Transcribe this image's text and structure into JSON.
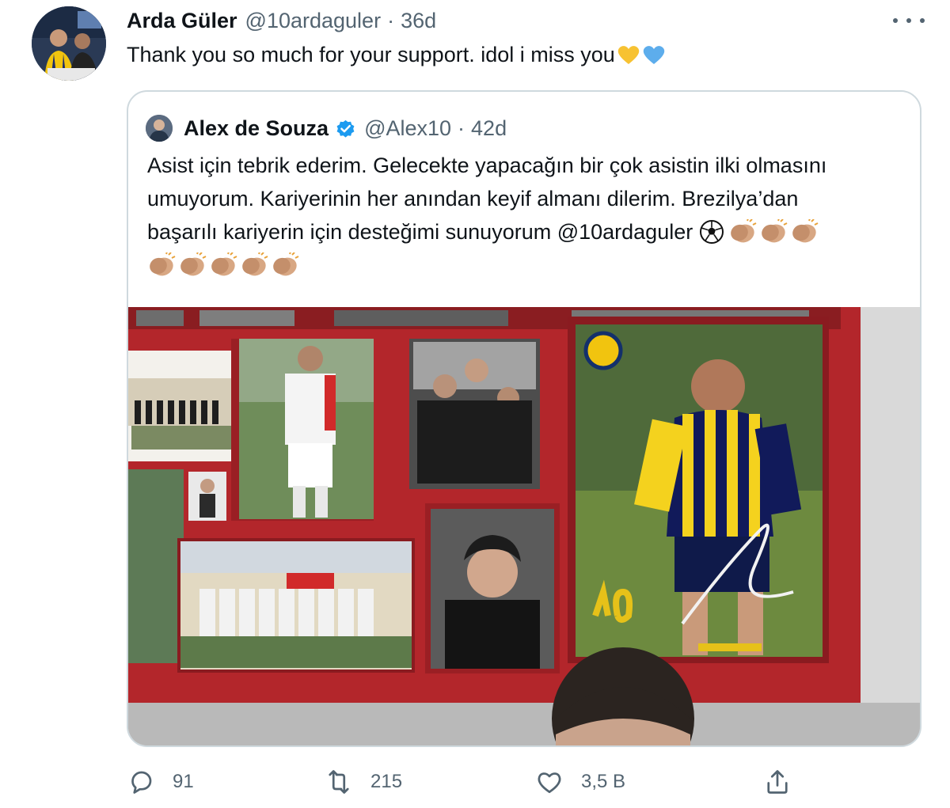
{
  "tweet": {
    "author_name": "Arda Güler",
    "author_handle": "@10ardaguler",
    "separator": "·",
    "time": "36d",
    "text": "Thank you so much for your support. idol i miss you",
    "emojis": [
      "yellow-heart",
      "blue-heart"
    ]
  },
  "quote": {
    "author_name": "Alex de Souza",
    "verified": true,
    "author_handle": "@Alex10",
    "separator": "·",
    "time": "42d",
    "lines": [
      "Asist için tebrik ederim. Gelecekte yapacağın bir çok asistin ilki olmasını",
      "umuyorum. Kariyerinin  her anından keyif almanı dilerim. Brezilya’dan",
      "başarılı kariyerin için desteğimi sunuyorum @10ardaguler"
    ],
    "line3_emojis": [
      "soccer-ball",
      "clapping-hands",
      "clapping-hands",
      "clapping-hands"
    ],
    "line4_emojis": [
      "clapping-hands",
      "clapping-hands",
      "clapping-hands",
      "clapping-hands",
      "clapping-hands"
    ],
    "media": "photo-collage-signed-jersey-frame"
  },
  "actions": {
    "reply": {
      "icon": "reply-icon",
      "count": "91"
    },
    "retweet": {
      "icon": "retweet-icon",
      "count": "215"
    },
    "like": {
      "icon": "heart-icon",
      "count": "3,5 B"
    },
    "share": {
      "icon": "share-icon"
    }
  },
  "colors": {
    "text": "#0f1419",
    "secondary": "#536471",
    "border": "#cfd9de",
    "verified": "#1d9bf0",
    "frame_red": "#c3262c"
  }
}
